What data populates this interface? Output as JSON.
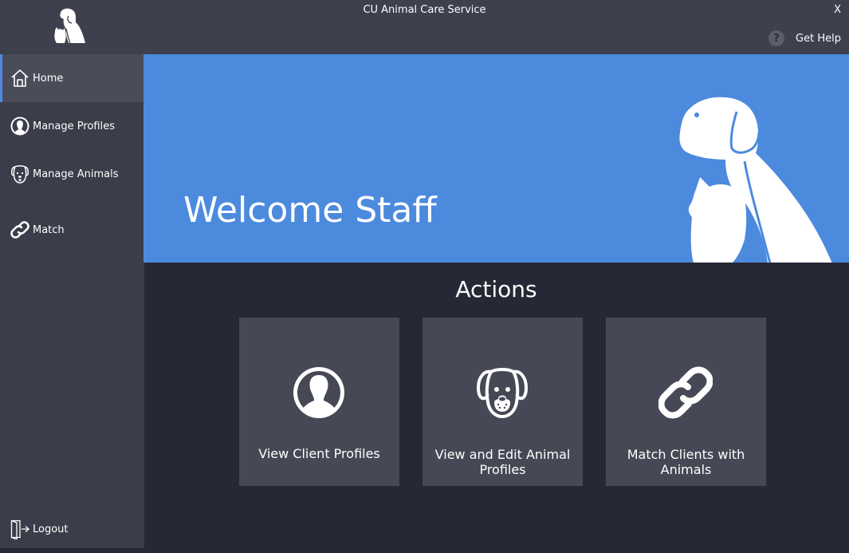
{
  "window": {
    "title": "CU Animal Care Service",
    "close_label": "X",
    "help_label": "Get Help",
    "help_icon_glyph": "?"
  },
  "sidebar": {
    "items": [
      {
        "label": "Home",
        "icon": "home-icon",
        "active": true
      },
      {
        "label": "Manage Profiles",
        "icon": "person-icon",
        "active": false
      },
      {
        "label": "Manage Animals",
        "icon": "dog-icon",
        "active": false
      },
      {
        "label": "Match",
        "icon": "link-icon",
        "active": false
      }
    ],
    "logout_label": "Logout"
  },
  "hero": {
    "welcome_text": "Welcome Staff"
  },
  "actions": {
    "title": "Actions",
    "cards": [
      {
        "label": "View Client Profiles",
        "icon": "person-icon"
      },
      {
        "label": "View and Edit Animal Profiles",
        "icon": "dog-icon"
      },
      {
        "label": "Match Clients with Animals",
        "icon": "link-icon"
      }
    ]
  },
  "colors": {
    "accent": "#4c8ade",
    "titlebar": "#3e404d",
    "sidebar": "#3b3d4a",
    "background": "#272836",
    "card": "#464855"
  }
}
